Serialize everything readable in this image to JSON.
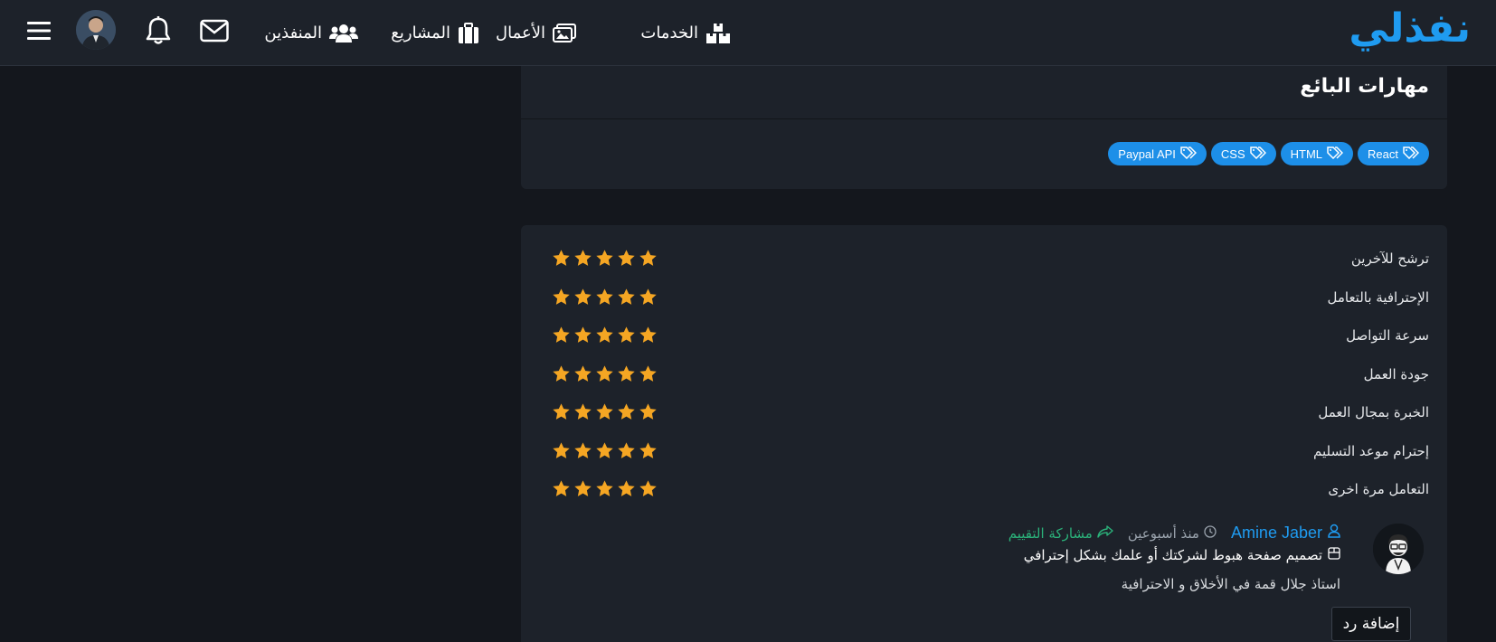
{
  "header": {
    "logo": "نفذلي",
    "nav": {
      "services": "الخدمات",
      "works": "الأعمال",
      "projects": "المشاريع",
      "freelancers": "المنفذين"
    }
  },
  "skills": {
    "title": "مهارات البائع",
    "tags": [
      "React",
      "HTML",
      "CSS",
      "Paypal API"
    ]
  },
  "ratings": {
    "rows": [
      {
        "label": "ترشح للآخرين",
        "stars": 5
      },
      {
        "label": "الإحترافية بالتعامل",
        "stars": 5
      },
      {
        "label": "سرعة التواصل",
        "stars": 5
      },
      {
        "label": "جودة العمل",
        "stars": 5
      },
      {
        "label": "الخبرة بمجال العمل",
        "stars": 5
      },
      {
        "label": "إحترام موعد التسليم",
        "stars": 5
      },
      {
        "label": "التعامل مرة اخرى",
        "stars": 5
      }
    ]
  },
  "review": {
    "reviewer": "Amine Jaber",
    "time": "منذ أسبوعين",
    "share": "مشاركة التقييم",
    "project": "تصميم صفحة هبوط لشركتك أو علمك بشكل إحترافي",
    "comment": "استاذ جلال قمة في الأخلاق و الاحترافية",
    "reply_label": "إضافة رد"
  },
  "colors": {
    "accent": "#1f9bf0",
    "star": "#f5a623",
    "share": "#2bb27a",
    "tag": "#1d8fe8"
  }
}
